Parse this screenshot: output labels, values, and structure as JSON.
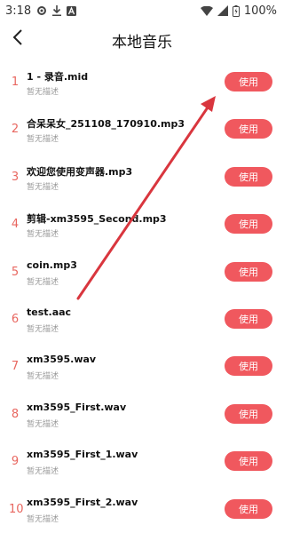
{
  "status_bar": {
    "time": "3:18",
    "battery_percent": "100%",
    "icons": [
      "gear-icon",
      "download-icon",
      "notification-a-icon",
      "wifi-icon",
      "signal-icon",
      "battery-icon"
    ]
  },
  "header": {
    "title": "本地音乐",
    "back_icon": "back-chevron-icon"
  },
  "list": {
    "items": [
      {
        "index": "1",
        "name": "1 - 录音.mid",
        "description": "暂无描述",
        "button": "使用"
      },
      {
        "index": "2",
        "name": "合呆呆女_251108_170910.mp3",
        "description": "暂无描述",
        "button": "使用"
      },
      {
        "index": "3",
        "name": "欢迎您使用变声器.mp3",
        "description": "暂无描述",
        "button": "使用"
      },
      {
        "index": "4",
        "name": "剪辑-xm3595_Second.mp3",
        "description": "暂无描述",
        "button": "使用"
      },
      {
        "index": "5",
        "name": "coin.mp3",
        "description": "暂无描述",
        "button": "使用"
      },
      {
        "index": "6",
        "name": "test.aac",
        "description": "暂无描述",
        "button": "使用"
      },
      {
        "index": "7",
        "name": "xm3595.wav",
        "description": "暂无描述",
        "button": "使用"
      },
      {
        "index": "8",
        "name": "xm3595_First.wav",
        "description": "暂无描述",
        "button": "使用"
      },
      {
        "index": "9",
        "name": "xm3595_First_1.wav",
        "description": "暂无描述",
        "button": "使用"
      },
      {
        "index": "10",
        "name": "xm3595_First_2.wav",
        "description": "暂无描述",
        "button": "使用"
      }
    ]
  },
  "colors": {
    "accent": "#f0585e",
    "index_text": "#e8665f",
    "annotation_arrow": "#d9363e"
  }
}
